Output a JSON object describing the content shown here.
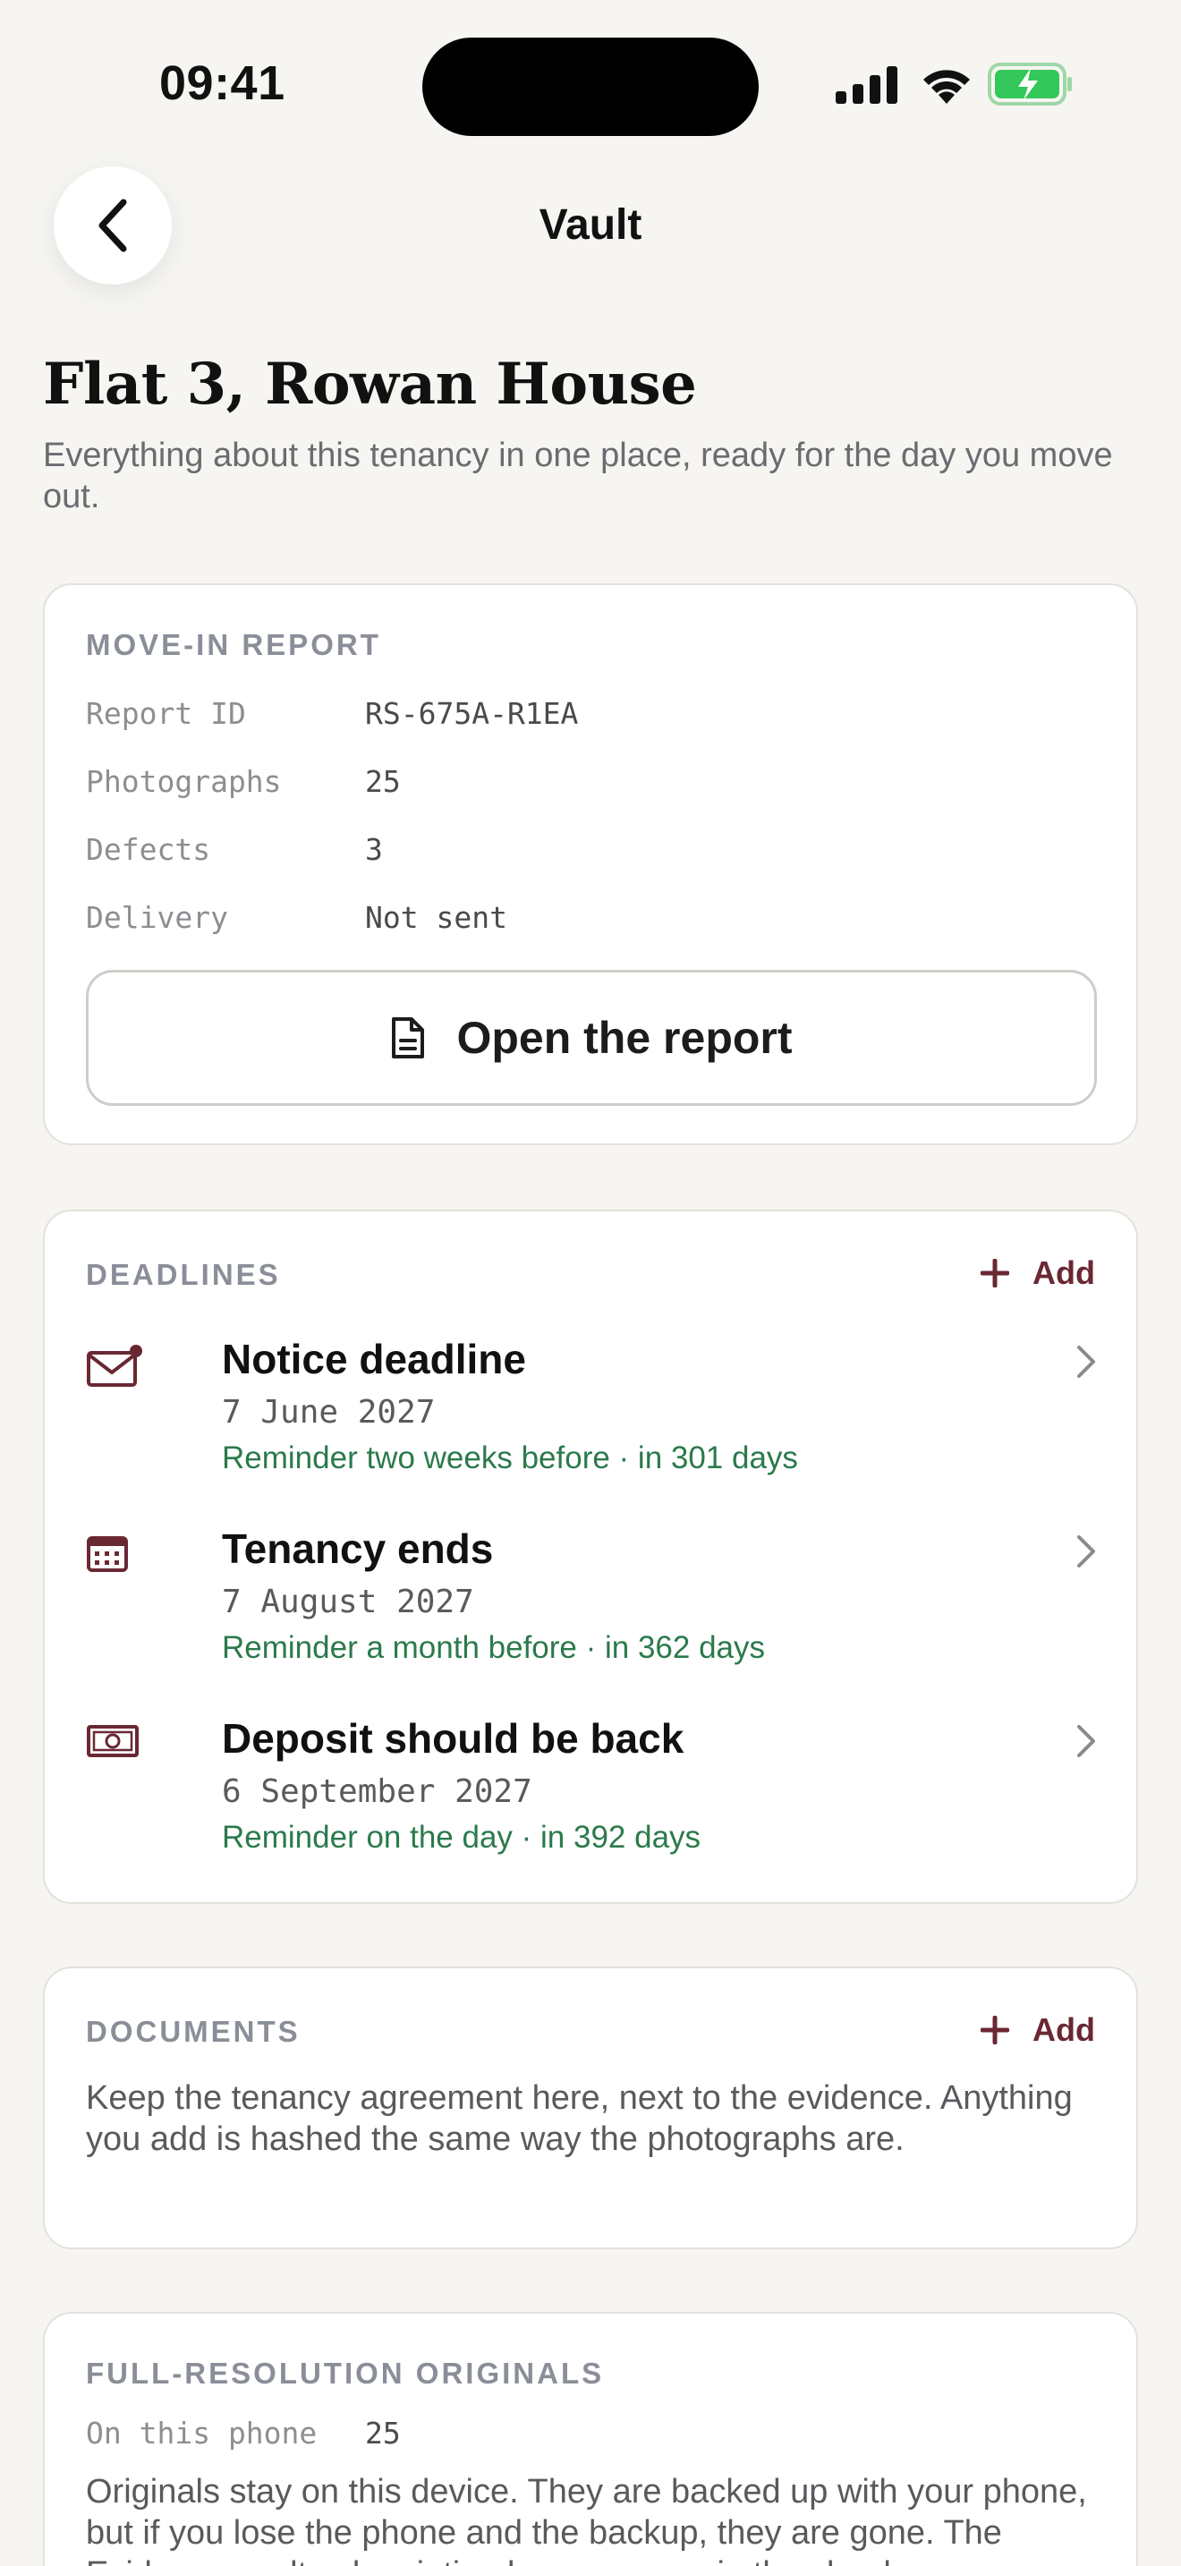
{
  "status_bar": {
    "time": "09:41"
  },
  "nav": {
    "title": "Vault"
  },
  "header": {
    "title": "Flat 3, Rowan House",
    "subtitle": "Everything about this tenancy in one place, ready for the day you move out."
  },
  "move_in_report": {
    "label": "MOVE-IN REPORT",
    "rows": [
      {
        "key": "Report ID",
        "value": "RS-675A-R1EA"
      },
      {
        "key": "Photographs",
        "value": "25"
      },
      {
        "key": "Defects",
        "value": "3"
      },
      {
        "key": "Delivery",
        "value": "Not sent"
      }
    ],
    "open_button": "Open the report"
  },
  "deadlines": {
    "label": "DEADLINES",
    "add": "Add",
    "items": [
      {
        "title": "Notice deadline",
        "date": "7 June 2027",
        "reminder": "Reminder two weeks before · in 301 days",
        "icon": "envelope-icon"
      },
      {
        "title": "Tenancy ends",
        "date": "7 August 2027",
        "reminder": "Reminder a month before · in 362 days",
        "icon": "calendar-icon"
      },
      {
        "title": "Deposit should be back",
        "date": "6 September 2027",
        "reminder": "Reminder on the day · in 392 days",
        "icon": "banknote-icon"
      }
    ]
  },
  "documents": {
    "label": "DOCUMENTS",
    "add": "Add",
    "text": "Keep the tenancy agreement here, next to the evidence. Anything you add is hashed the same way the photographs are."
  },
  "originals": {
    "label": "FULL-RESOLUTION ORIGINALS",
    "key": "On this phone",
    "value": "25",
    "text": "Originals stay on this device. They are backed up with your phone, but if you lose the phone and the backup, they are gone. The Evidence vault subscription keeps a copy in the cloud."
  },
  "colors": {
    "accent": "#6a2833",
    "reminder": "#2b7a4b",
    "background": "#f6f5f2"
  }
}
